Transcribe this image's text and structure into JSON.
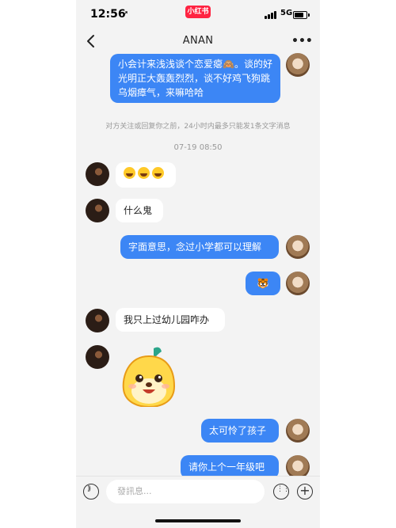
{
  "status_bar": {
    "time": "12:56",
    "app_badge": "小红书",
    "network": "5G"
  },
  "header": {
    "title": "ANAN",
    "more_label": "•••"
  },
  "messages": [
    {
      "side": "right",
      "text": "小会计来浅浅谈个恋爱瘪🙈。谈的好光明正大轰轰烈烈，谈不好鸡飞狗跳乌烟瘴气，来嘛哈哈"
    },
    {
      "side": "left",
      "text": "😂😂😂"
    },
    {
      "side": "left",
      "text": "什么鬼"
    },
    {
      "side": "right",
      "text": "字面意思，念过小学都可以理解"
    },
    {
      "side": "right",
      "text": "🐯"
    },
    {
      "side": "left",
      "text": "我只上过幼儿园咋办"
    },
    {
      "side": "left",
      "type": "sticker",
      "text": ""
    },
    {
      "side": "right",
      "text": "太可怜了孩子"
    },
    {
      "side": "right",
      "text": "请你上个一年级吧"
    }
  ],
  "system": {
    "notice": "对方关注或回复你之前，24小时内最多只能发1条文字消息",
    "timestamp": "07-19 08:50"
  },
  "input_bar": {
    "placeholder": "發訊息..."
  },
  "icons": [
    "back-chevron-icon",
    "more-dots-icon",
    "voice-icon",
    "emoji-icon",
    "plus-icon"
  ]
}
